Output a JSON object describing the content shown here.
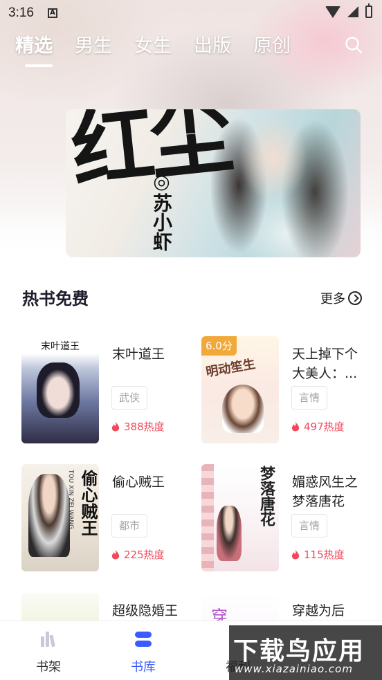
{
  "status_bar": {
    "time": "3:16",
    "notification_badge": "A"
  },
  "top_tabs": [
    {
      "label": "精选",
      "active": true
    },
    {
      "label": "男生",
      "active": false
    },
    {
      "label": "女生",
      "active": false
    },
    {
      "label": "出版",
      "active": false
    },
    {
      "label": "原创",
      "active": false
    }
  ],
  "banner": {
    "calligraphy": "红尘",
    "author": "◎苏小虾"
  },
  "section": {
    "title": "热书免费",
    "more_label": "更多"
  },
  "books": [
    {
      "title": "末叶道王",
      "tag": "武侠",
      "heat": "388热度",
      "cover_text": "末叶道王"
    },
    {
      "title": "天上掉下个大美人：...",
      "tag": "言情",
      "heat": "497热度",
      "cover_text": "明动笙生",
      "score": "6.0分"
    },
    {
      "title": "偷心贼王",
      "tag": "都市",
      "heat": "225热度",
      "cover_text": "偷心贼王",
      "cover_pinyin": "TOU XIN ZEI WANG"
    },
    {
      "title": "媚惑风生之梦落唐花",
      "tag": "言情",
      "heat": "115热度",
      "cover_text": "梦落唐花"
    },
    {
      "title": "超级隐婚王",
      "tag": "",
      "heat": ""
    },
    {
      "title": "穿越为后",
      "tag": "",
      "heat": "",
      "cover_text": "穿"
    }
  ],
  "bottom_nav": [
    {
      "label": "书架",
      "active": false
    },
    {
      "label": "书库",
      "active": true
    },
    {
      "label": "福利",
      "active": false
    }
  ],
  "watermark": {
    "main": "下载鸟应用",
    "sub": "www.xiazainiao.com"
  },
  "colors": {
    "accent": "#3b5bff",
    "heat": "#f04a5a",
    "title": "#1d1d2b"
  }
}
